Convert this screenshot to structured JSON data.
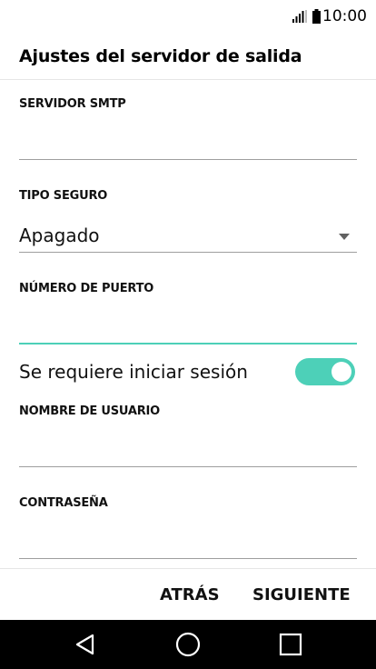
{
  "status_bar": {
    "time": "10:00",
    "icons": [
      "signal-icon",
      "battery-icon"
    ]
  },
  "header": {
    "title": "Ajustes del servidor de salida"
  },
  "form": {
    "smtp_server": {
      "label": "SERVIDOR SMTP",
      "value": ""
    },
    "security_type": {
      "label": "TIPO SEGURO",
      "value": "Apagado"
    },
    "port": {
      "label": "NÚMERO DE PUERTO",
      "value": ""
    },
    "require_login": {
      "label": "Se requiere iniciar sesión",
      "enabled": true
    },
    "username": {
      "label": "NOMBRE DE USUARIO",
      "value": ""
    },
    "password": {
      "label": "CONTRASEÑA",
      "value": ""
    }
  },
  "actions": {
    "back_label": "ATRÁS",
    "next_label": "SIGUIENTE"
  },
  "nav": {
    "icons": [
      "back-triangle-icon",
      "home-circle-icon",
      "recent-square-icon"
    ]
  },
  "colors": {
    "accent": "#4dd0b8",
    "nav_background": "#000000"
  }
}
